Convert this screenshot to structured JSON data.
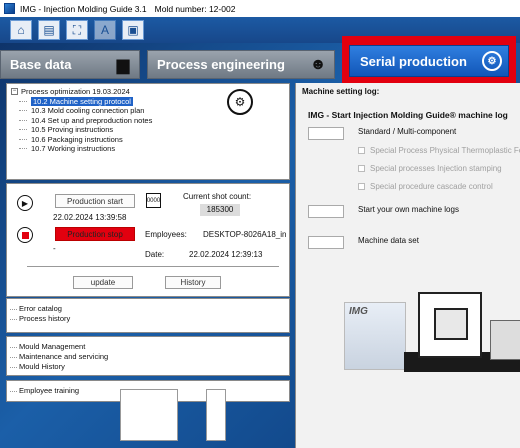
{
  "window": {
    "title": "IMG - Injection Molding Guide 3.1",
    "mold_number": "Mold number: 12-002"
  },
  "toolbar": {
    "icons": [
      "home-icon",
      "machine-icon",
      "network-icon",
      "translate-icon",
      "image-icon"
    ]
  },
  "tabs": [
    {
      "label": "Base data",
      "icon": "folder-icon"
    },
    {
      "label": "Process engineering",
      "icon": "engineer-icon"
    },
    {
      "label": "Serial production",
      "icon": "gear-icon",
      "active": true
    }
  ],
  "tree": {
    "root": "Process optimization 19.03.2024",
    "items": [
      "10.2 Machine setting protocol",
      "10.3 Mold cooling connection plan",
      "10.4 Set up and preproduction notes",
      "10.5 Proving instructions",
      "10.6 Packaging instructions",
      "10.7 Working instructions"
    ],
    "selected_index": 0
  },
  "production": {
    "start_label": "Production start",
    "start_date": "22.02.2024 13:39:58",
    "stop_label": "Production stop",
    "stop_info": "-",
    "shot_count_label": "Current shot count:",
    "shot_count": "185300",
    "employee_label": "Employees:",
    "employee_value": "DESKTOP-8026A18_in",
    "date_label": "Date:",
    "date_value": "22.02.2024 12:39:13",
    "update_label": "update",
    "history_label": "History"
  },
  "lists": {
    "catalog": [
      "Error catalog",
      "Process history"
    ],
    "mould": [
      "Mould Management",
      "Maintenance and servicing",
      "Mould History"
    ],
    "employee": [
      "Employee training"
    ]
  },
  "machine_log": {
    "title": "Machine setting log:",
    "heading": "IMG - Start Injection Molding Guide® machine log",
    "standard": "Standard / Multi-component",
    "options": [
      "Special Process Physical Thermoplastic Foam",
      "Special processes Injection stamping",
      "Special procedure cascade control"
    ],
    "own_logs": "Start your own machine logs",
    "data_set": "Machine data set",
    "logo_text": "IMG"
  }
}
